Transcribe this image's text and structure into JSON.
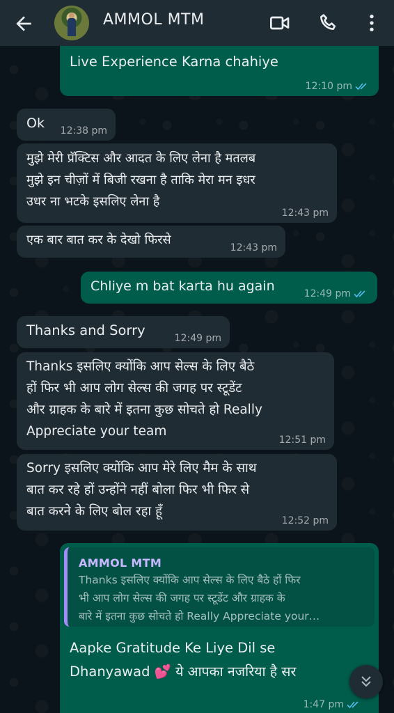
{
  "header": {
    "contact_name": "AMMOL MTM"
  },
  "messages": [
    {
      "dir": "out",
      "text": "Live Experience Karna chahiye",
      "time": "12:10 pm"
    },
    {
      "dir": "in",
      "text": "Ok",
      "time": "12:38 pm"
    },
    {
      "dir": "in",
      "lines": [
        "मुझे मेरी प्रॅक्टिस और आदत के लिए लेना है मतलब",
        "मुझे इन चीज़ों में बिजी रखना है ताकि मेरा मन इधर",
        "उधर ना भटके इसलिए लेना है"
      ],
      "time": "12:43 pm"
    },
    {
      "dir": "in",
      "text": "एक बार बात कर के देखो फिरसे",
      "time": "12:43 pm"
    },
    {
      "dir": "out",
      "text": "Chliye m bat karta hu again",
      "time": "12:49 pm"
    },
    {
      "dir": "in",
      "text": "Thanks and Sorry",
      "time": "12:49 pm"
    },
    {
      "dir": "in",
      "lines": [
        "Thanks इसलिए क्योंकि आप सेल्स के लिए बैठे",
        "हों फिर भी आप लोग सेल्स की जगह पर स्टूडेंट",
        "और ग्राहक के बारे में इतना कुछ सोचते हो Really",
        "Appreciate your team"
      ],
      "time": "12:51 pm"
    },
    {
      "dir": "in",
      "lines": [
        "Sorry इसलिए क्योंकि आप मेरे लिए मैम के साथ",
        "बात कर रहे हों उन्होंने नहीं बोला फिर भी फिर से",
        "बात करने के लिए बोल रहा हूँ"
      ],
      "time": "12:52 pm"
    },
    {
      "dir": "out",
      "quote": {
        "name": "AMMOL MTM",
        "lines": [
          "Thanks इसलिए क्योंकि आप सेल्स के लिए बैठे हों फिर",
          "भी आप लोग सेल्स की जगह पर स्टूडेंट और ग्राहक के",
          "बारे में इतना कुछ सोचते हो Really Appreciate your…"
        ]
      },
      "lines": [
        "Aapke Gratitude Ke Liye Dil se",
        "Dhanyawad 💕 ये आपका नजरिया है सर"
      ],
      "time": "1:47 pm"
    }
  ],
  "colors": {
    "incoming": "#202c33",
    "outgoing": "#005c4b",
    "read_ticks": "#53bdeb",
    "header": "#1f2c33"
  },
  "icons": [
    "back-arrow-icon",
    "video-call-icon",
    "voice-call-icon",
    "more-options-icon",
    "scroll-down-icon"
  ]
}
